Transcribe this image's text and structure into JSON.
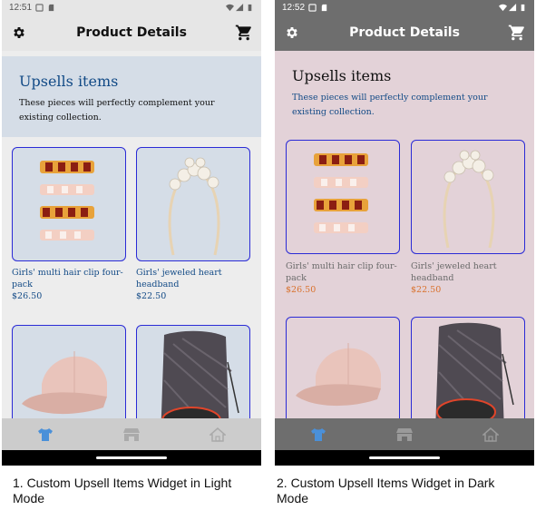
{
  "light": {
    "status": {
      "time": "12:51"
    },
    "app_bar": {
      "title": "Product Details"
    },
    "section": {
      "title": "Upsells items",
      "description": "These pieces will perfectly complement your existing collection."
    },
    "products": [
      {
        "name": "Girls' multi hair clip four-pack",
        "price": "$26.50"
      },
      {
        "name": "Girls' jeweled heart headband",
        "price": "$22.50"
      }
    ],
    "caption": "1. Custom Upsell Items Widget in Light Mode"
  },
  "dark": {
    "status": {
      "time": "12:52"
    },
    "app_bar": {
      "title": "Product Details"
    },
    "section": {
      "title": "Upsells items",
      "description": "These pieces will perfectly complement your existing collection."
    },
    "products": [
      {
        "name": "Girls' multi hair clip four-pack",
        "price": "$26.50"
      },
      {
        "name": "Girls' jeweled heart headband",
        "price": "$22.50"
      }
    ],
    "caption": "2. Custom Upsell Items Widget in Dark Mode"
  },
  "icons": {
    "settings": "gear-icon",
    "cart": "shopping-cart-icon",
    "nav": [
      "tshirt-icon",
      "store-icon",
      "home-icon"
    ]
  },
  "colors": {
    "card_border": "#2b2bd6",
    "nav_active": "#4a90d9",
    "title_blue": "#124a86",
    "price_orange": "#d9712c"
  }
}
